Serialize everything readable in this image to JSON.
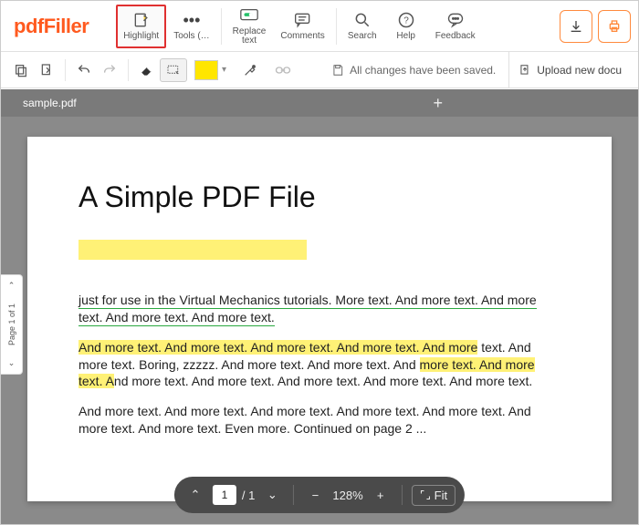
{
  "branding": {
    "logo_text": "pdfFiller"
  },
  "toolbar": {
    "highlight_label": "Highlight",
    "tools_label": "Tools (…",
    "replace_label": "Replace",
    "replace_label2": "text",
    "comments_label": "Comments",
    "search_label": "Search",
    "help_label": "Help",
    "feedback_label": "Feedback"
  },
  "subbar": {
    "status_text": "All changes have been saved.",
    "upload_label": "Upload new docu"
  },
  "tabbar": {
    "tab_label": "sample.pdf",
    "add_tab_glyph": "+"
  },
  "side": {
    "up_glyph": "⌃",
    "down_glyph": "⌄",
    "page_text": "Page 1 of 1"
  },
  "document": {
    "title": "A Simple PDF File",
    "para1": "just for use in the Virtual Mechanics tutorials. More text. And more text. And more text. And more text. And more text.",
    "para2_hl": "And more text. And more text. And more text. And more text. And more",
    "para2_a": " text. And more text. Boring, zzzzz. And more text. And more text. And ",
    "para2_hl2": "more text. And more text. A",
    "para2_b": "nd more text. And more text. And more text. And more text. And more text.",
    "para3": "And more text. And more text. And more text. And more text. And more text. And more text. And more text. Even more. Continued on page 2 ..."
  },
  "floatbar": {
    "page_current": "1",
    "page_total": "/ 1",
    "zoom_label": "128%",
    "fit_label": "Fit"
  }
}
